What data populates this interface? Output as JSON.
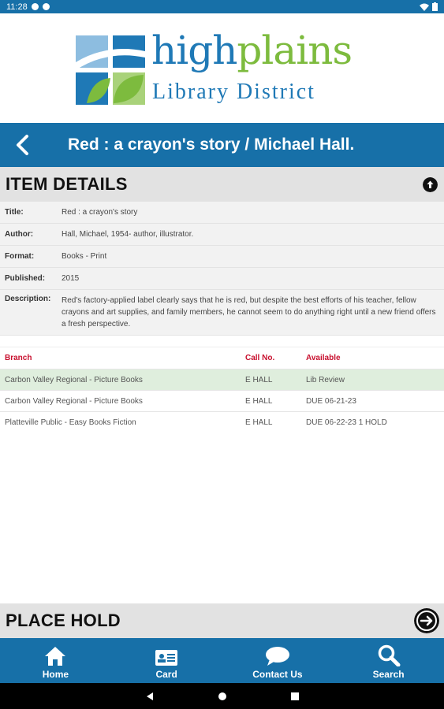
{
  "status_bar": {
    "time": "11:28"
  },
  "logo": {
    "word1": "high",
    "word2": "plains",
    "subtitle": "Library District"
  },
  "header": {
    "title": "Red : a crayon's story / Michael Hall."
  },
  "item_details": {
    "heading": "ITEM DETAILS",
    "rows": [
      {
        "label": "Title:",
        "value": "Red : a crayon's story"
      },
      {
        "label": "Author:",
        "value": "Hall, Michael, 1954- author, illustrator."
      },
      {
        "label": "Format:",
        "value": "Books - Print"
      },
      {
        "label": "Published:",
        "value": "2015"
      },
      {
        "label": "Description:",
        "value": "Red's factory-applied label clearly says that he is red, but despite the best efforts of his teacher, fellow crayons and art supplies, and family members, he cannot seem to do anything right until a new friend offers a fresh perspective."
      }
    ]
  },
  "availability": {
    "columns": {
      "branch": "Branch",
      "call_no": "Call No.",
      "available": "Available"
    },
    "rows": [
      {
        "branch": "Carbon Valley Regional - Picture Books",
        "call_no": "E HALL",
        "available": "Lib Review"
      },
      {
        "branch": "Carbon Valley Regional - Picture Books",
        "call_no": "E HALL",
        "available": "DUE 06-21-23"
      },
      {
        "branch": "Platteville Public - Easy Books Fiction",
        "call_no": "E HALL",
        "available": "DUE 06-22-23 1 HOLD"
      }
    ]
  },
  "place_hold": {
    "heading": "PLACE HOLD"
  },
  "bottom_nav": [
    {
      "label": "Home",
      "icon": "home-icon"
    },
    {
      "label": "Card",
      "icon": "card-icon"
    },
    {
      "label": "Contact Us",
      "icon": "chat-icon"
    },
    {
      "label": "Search",
      "icon": "search-icon"
    }
  ],
  "colors": {
    "primary": "#1770a8",
    "logo_blue": "#1f79b6",
    "logo_green": "#7dbb3e",
    "header_red": "#c8102e",
    "highlight_row": "#dfeedd"
  }
}
